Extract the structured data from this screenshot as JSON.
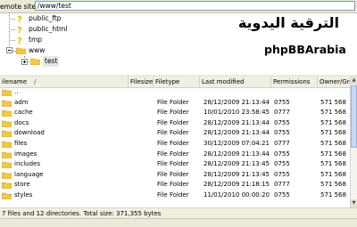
{
  "remote_site": {
    "label": "emote site:",
    "path": "/www/test"
  },
  "tree": {
    "items": [
      {
        "name": "public_ftp",
        "icon": "question-folder-icon"
      },
      {
        "name": "public_html",
        "icon": "question-folder-icon"
      },
      {
        "name": "tmp",
        "icon": "question-folder-icon"
      },
      {
        "name": "www",
        "icon": "folder-icon"
      },
      {
        "name": "test",
        "icon": "folder-icon"
      }
    ]
  },
  "logo": {
    "arabic": "الترقية اليدوية",
    "english": "phpBBArabia"
  },
  "columns": {
    "filename": "ilename",
    "sort_arrow": "/",
    "filesize": "Filesize",
    "filetype": "Filetype",
    "last_modified": "Last modified",
    "permissions": "Permissions",
    "owner_group": "Owner/Grou"
  },
  "files": [
    {
      "name": "..",
      "type": "",
      "modified": "",
      "perms": "",
      "owner": ""
    },
    {
      "name": "adm",
      "type": "File Folder",
      "modified": "28/12/2009 21:13:44",
      "perms": "0755",
      "owner": "571 568"
    },
    {
      "name": "cache",
      "type": "File Folder",
      "modified": "10/01/2010 23:58:45",
      "perms": "0777",
      "owner": "571 568"
    },
    {
      "name": "docs",
      "type": "File Folder",
      "modified": "28/12/2009 21:13:44",
      "perms": "0755",
      "owner": "571 568"
    },
    {
      "name": "download",
      "type": "File Folder",
      "modified": "28/12/2009 21:13:44",
      "perms": "0755",
      "owner": "571 568"
    },
    {
      "name": "files",
      "type": "File Folder",
      "modified": "30/12/2009 07:04:21",
      "perms": "0777",
      "owner": "571 568"
    },
    {
      "name": "images",
      "type": "File Folder",
      "modified": "28/12/2009 21:13:44",
      "perms": "0755",
      "owner": "571 568"
    },
    {
      "name": "includes",
      "type": "File Folder",
      "modified": "28/12/2009 21:13:45",
      "perms": "0755",
      "owner": "571 568"
    },
    {
      "name": "language",
      "type": "File Folder",
      "modified": "28/12/2009 21:13:45",
      "perms": "0755",
      "owner": "571 568"
    },
    {
      "name": "store",
      "type": "File Folder",
      "modified": "28/12/2009 21:18:15",
      "perms": "0777",
      "owner": "571 568"
    },
    {
      "name": "styles",
      "type": "File Folder",
      "modified": "11/01/2010 00:00:20",
      "perms": "0755",
      "owner": "571 568"
    }
  ],
  "status": "7 files and 12 directories. Total size: 371,355 bytes",
  "colors": {
    "folder": "#f0c94a",
    "folder_edge": "#c99a1c",
    "question": "#e8b800"
  }
}
